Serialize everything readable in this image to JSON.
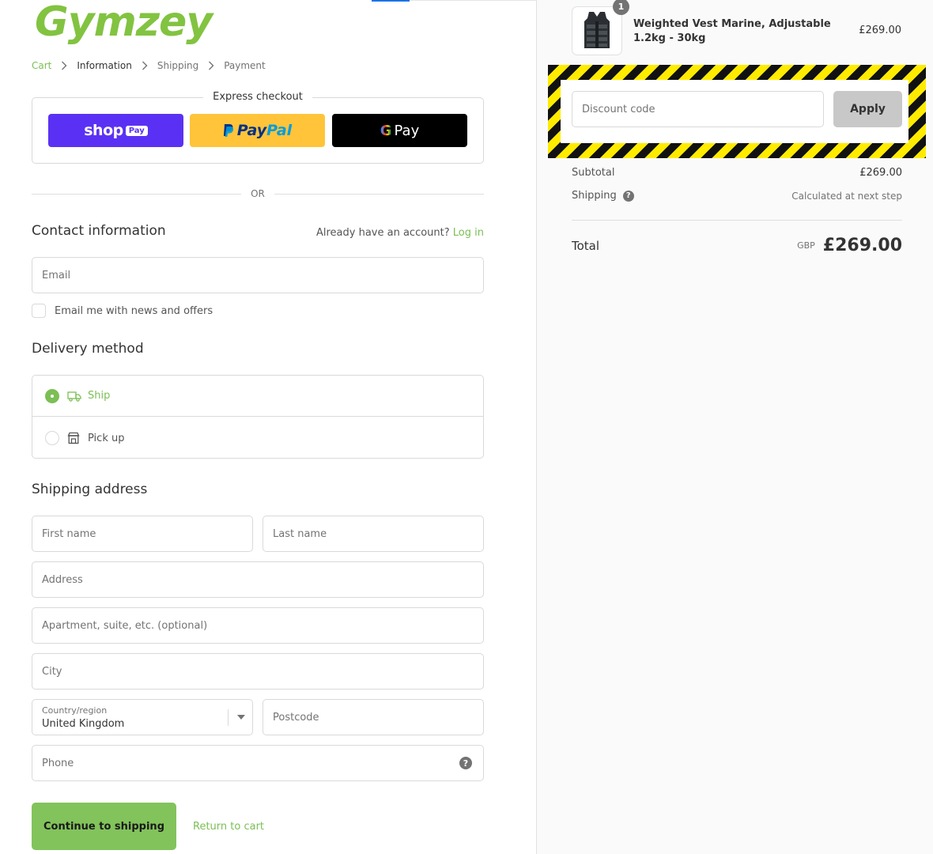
{
  "brand": {
    "logo_text": "Gymzey",
    "accent_color": "#82c341"
  },
  "breadcrumb": [
    {
      "label": "Cart",
      "state": "link"
    },
    {
      "label": "Information",
      "state": "current"
    },
    {
      "label": "Shipping",
      "state": "upcoming"
    },
    {
      "label": "Payment",
      "state": "upcoming"
    }
  ],
  "express_checkout": {
    "title": "Express checkout",
    "shop_pay": {
      "word": "shop",
      "pill": "Pay"
    },
    "paypal": {
      "word_1": "Pay",
      "word_2": "Pal"
    },
    "gpay": {
      "g": "G",
      "word": "Pay"
    }
  },
  "divider_text": "OR",
  "contact": {
    "title": "Contact information",
    "account_prompt": "Already have an account?",
    "login_label": "Log in",
    "email_placeholder": "Email",
    "news_label": "Email me with news and offers"
  },
  "delivery": {
    "title": "Delivery method",
    "options": [
      {
        "label": "Ship",
        "selected": true,
        "icon": "truck-icon"
      },
      {
        "label": "Pick up",
        "selected": false,
        "icon": "store-icon"
      }
    ]
  },
  "shipping_address": {
    "title": "Shipping address",
    "first_name": "First name",
    "last_name": "Last name",
    "address": "Address",
    "apartment": "Apartment, suite, etc. (optional)",
    "city": "City",
    "country_label": "Country/region",
    "country_value": "United Kingdom",
    "postcode": "Postcode",
    "phone": "Phone",
    "help": "?"
  },
  "actions": {
    "continue_label": "Continue to shipping",
    "return_label": "Return to cart"
  },
  "summary": {
    "product": {
      "name": "Weighted Vest Marine, Adjustable 1.2kg - 30kg",
      "price": "£269.00",
      "quantity": "1"
    },
    "discount_placeholder": "Discount code",
    "apply_label": "Apply",
    "subtotal_label": "Subtotal",
    "subtotal_value": "£269.00",
    "shipping_label": "Shipping",
    "shipping_value": "Calculated at next step",
    "shipping_help": "?",
    "total_label": "Total",
    "currency": "GBP",
    "total_value": "£269.00"
  }
}
